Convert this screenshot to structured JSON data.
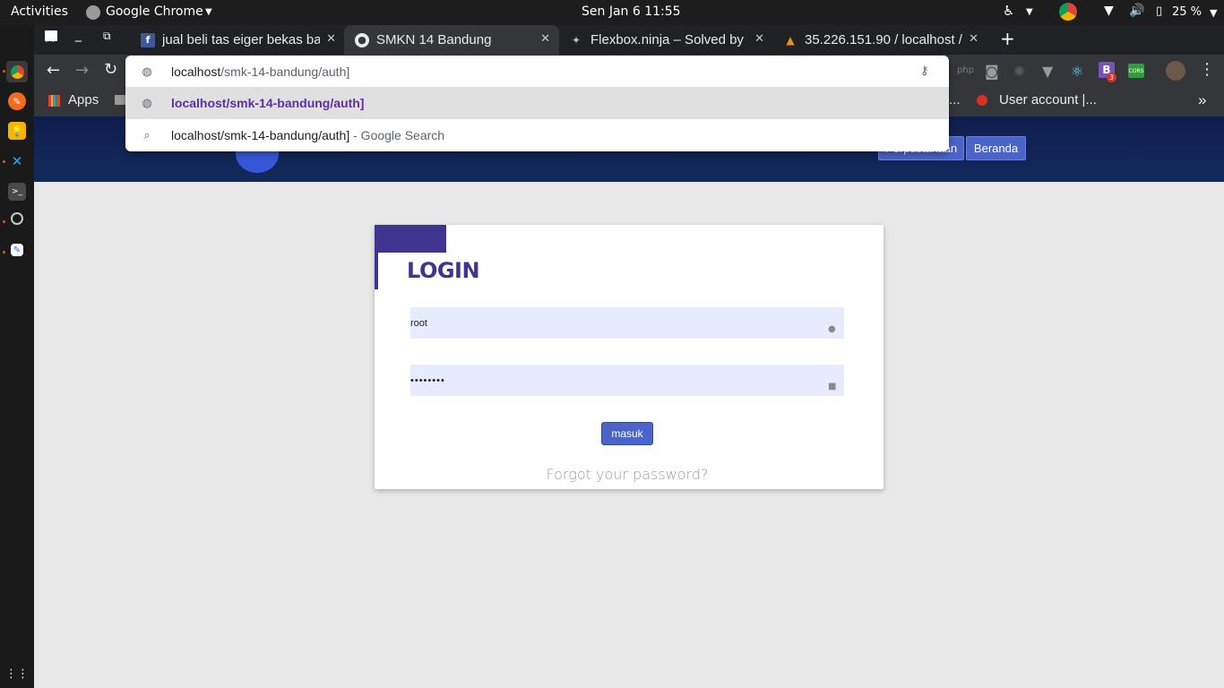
{
  "topbar": {
    "activities": "Activities",
    "app_name": "Google Chrome",
    "datetime": "Sen Jan 6  11:55",
    "battery": "25 %"
  },
  "tabs": [
    {
      "title": "jual beli tas eiger bekas ba",
      "favicon": "facebook-icon"
    },
    {
      "title": "SMKN 14 Bandung",
      "favicon": "globe-icon"
    },
    {
      "title": "Flexbox.ninja – Solved by F",
      "favicon": "ninja-icon"
    },
    {
      "title": "35.226.151.90 / localhost /",
      "favicon": "phpmyadmin-icon"
    }
  ],
  "omnibox": {
    "input_host": "localhost",
    "input_path": "/smk-14-bandung/auth]",
    "suggestions": [
      {
        "text": "localhost/smk-14-bandung/auth]",
        "suffix": ""
      },
      {
        "text": "localhost/smk-14-bandung/auth]",
        "suffix": " - Google Search"
      }
    ]
  },
  "bookmarks": {
    "apps": "Apps",
    "ellipsis": "...",
    "user_account": "User account |...",
    "more": "»"
  },
  "extensions": {
    "badge_count": "3",
    "cors": "CORS"
  },
  "header": {
    "btn_perpustakaan": "Perpustakaan",
    "btn_beranda": "Beranda"
  },
  "login": {
    "title": "LOGIN",
    "username_value": "root",
    "password_value": "••••••••",
    "submit_label": "masuk",
    "forgot_label": "Forgot your password?"
  },
  "colors": {
    "brand_primary": "#3f3591",
    "button_blue": "#4a64c9",
    "header_bg": "#0e1e4e",
    "input_bg": "#e8eafd"
  }
}
